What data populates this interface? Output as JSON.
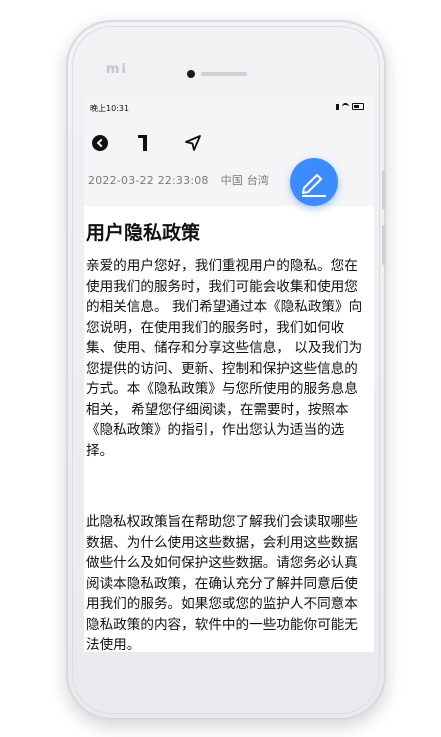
{
  "device": {
    "brand_logo": "mi"
  },
  "statusbar": {
    "time": "晚上10:31"
  },
  "toolbar": {
    "icons": [
      "back-icon",
      "bookmark-icon",
      "share-icon"
    ]
  },
  "meta": {
    "date": "2022-03-22 22:33:08",
    "location": "中国 台湾"
  },
  "fab": {
    "icon": "edit-pencil-icon",
    "color": "#3d8cff"
  },
  "document": {
    "title": "用户隐私政策",
    "paragraphs": [
      "亲爱的用户您好，我们重视用户的隐私。您在使用我们的服务时，我们可能会收集和使用您的相关信息。 我们希望通过本《隐私政策》向您说明，在使用我们的服务时，我们如何收集、使用、储存和分享这些信息， 以及我们为您提供的访问、更新、控制和保护这些信息的方式。本《隐私政策》与您所使用的服务息息相关， 希望您仔细阅读，在需要时，按照本《隐私政策》的指引，作出您认为适当的选择。",
      "此隐私权政策旨在帮助您了解我们会读取哪些数据、为什么使用这些数据，会利用这些数据做些什么及如何保护这些数据。请您务必认真阅读本隐私政策，在确认充分了解并同意后使用我们的服务。如果您或您的监护人不同意本隐私政策的内容，软件中的一些功能你可能无法使用。"
    ]
  }
}
